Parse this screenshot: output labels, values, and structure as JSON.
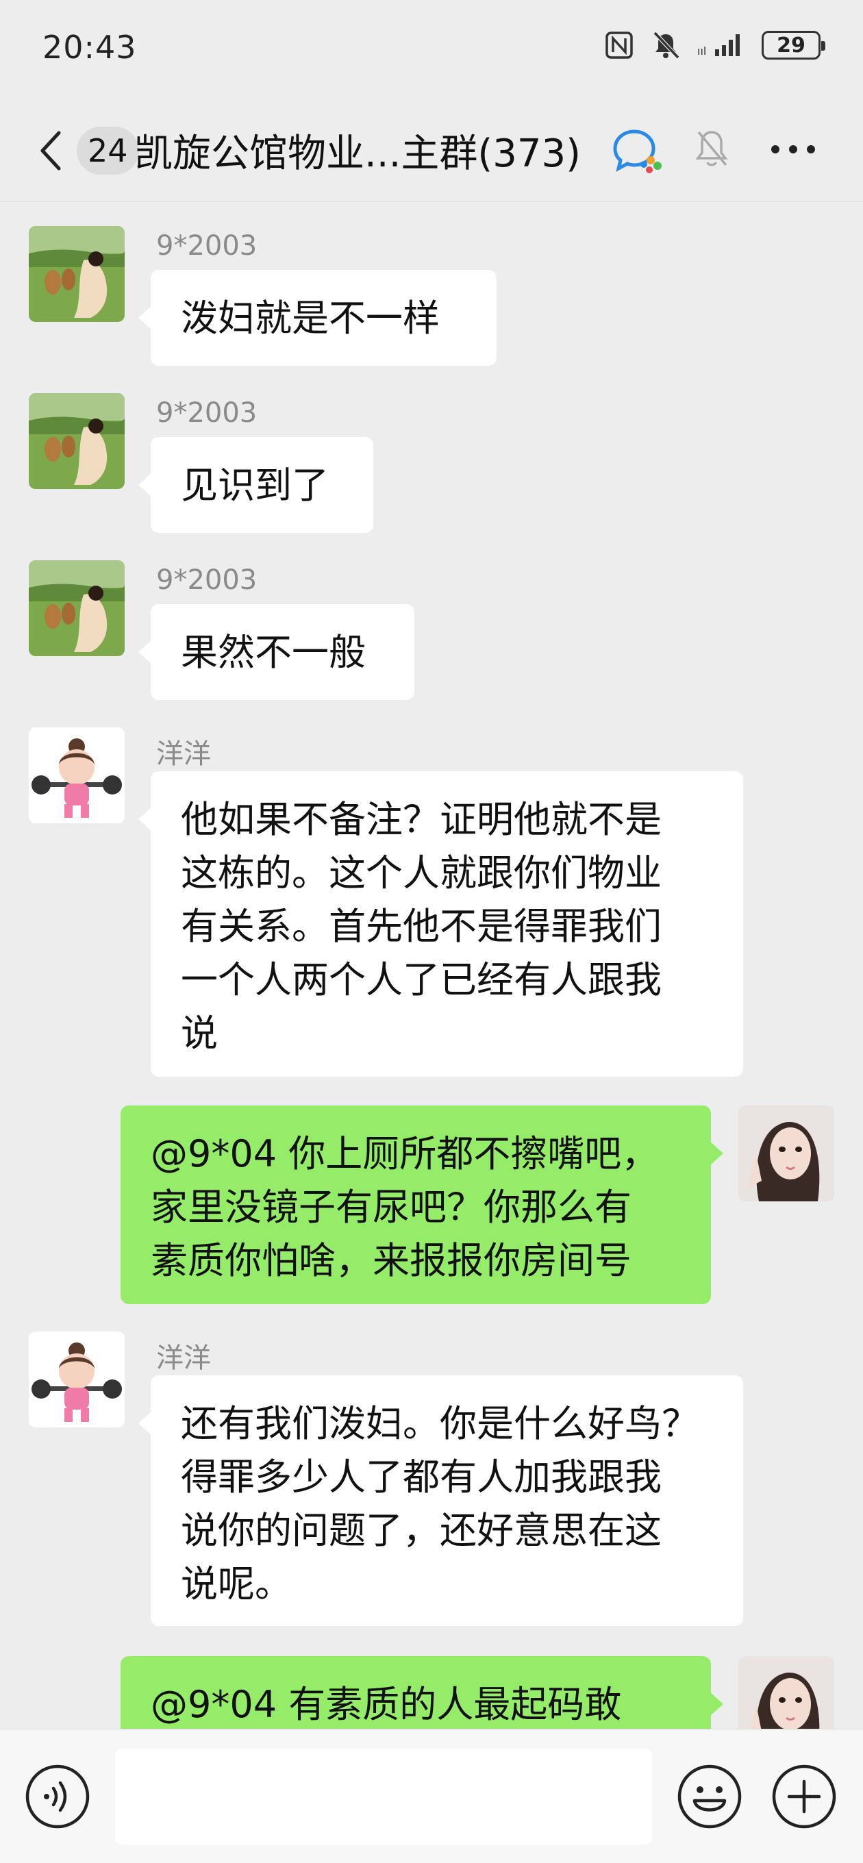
{
  "status_bar": {
    "time": "20:43",
    "battery": "29",
    "icons": [
      "nfc-icon",
      "silent-bell-icon",
      "signal-icon",
      "battery-icon"
    ]
  },
  "nav": {
    "unread_count": "24",
    "title": "凯旋公馆物业...主群(373)",
    "icons": [
      "back-icon",
      "chat-app-icon",
      "mute-bell-icon",
      "more-icon"
    ]
  },
  "messages": [
    {
      "sender": "9*2003",
      "lines": [
        "泼妇就是不一样"
      ],
      "direction": "in"
    },
    {
      "sender": "9*2003",
      "lines": [
        "见识到了"
      ],
      "direction": "in"
    },
    {
      "sender": "9*2003",
      "lines": [
        "果然不一般"
      ],
      "direction": "in"
    },
    {
      "sender": "洋洋",
      "lines": [
        "他如果不备注？证明他就不是",
        "这栋的。这个人就跟你们物业",
        "有关系。首先他不是得罪我们",
        "一个人两个人了已经有人跟我",
        "说"
      ],
      "direction": "in"
    },
    {
      "lines": [
        "@9*04 你上厕所都不擦嘴吧，",
        "家里没镜子有尿吧？你那么有",
        "素质你怕啥，来报报你房间号"
      ],
      "direction": "out"
    },
    {
      "sender": "洋洋",
      "lines": [
        "还有我们泼妇。你是什么好鸟？",
        "得罪多少人了都有人加我跟我",
        "说你的问题了，还好意思在这",
        "说呢。"
      ],
      "direction": "in"
    },
    {
      "lines": [
        "@9*04 有素质的人最起码敢"
      ],
      "direction": "out"
    }
  ],
  "input_bar": {
    "placeholder": "",
    "icons": [
      "voice-icon",
      "emoji-icon",
      "plus-icon"
    ]
  },
  "colors": {
    "background": "#ededed",
    "incoming_bubble": "#ffffff",
    "outgoing_bubble": "#95ec69"
  }
}
